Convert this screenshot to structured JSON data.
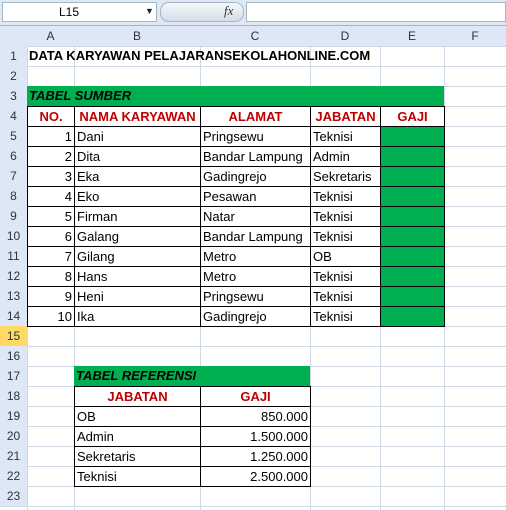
{
  "namebox": "L15",
  "fx": "fx",
  "columns": [
    "A",
    "B",
    "C",
    "D",
    "E",
    "F"
  ],
  "rows": [
    "1",
    "2",
    "3",
    "4",
    "5",
    "6",
    "7",
    "8",
    "9",
    "10",
    "11",
    "12",
    "13",
    "14",
    "15",
    "16",
    "17",
    "18",
    "19",
    "20",
    "21",
    "22",
    "23"
  ],
  "title": "DATA KARYAWAN PELAJARANSEKOLAHONLINE.COM",
  "tabel_sumber": {
    "label": "TABEL SUMBER",
    "headers": [
      "NO.",
      "NAMA KARYAWAN",
      "ALAMAT",
      "JABATAN",
      "GAJI"
    ],
    "rows": [
      [
        "1",
        "Dani",
        "Pringsewu",
        "Teknisi"
      ],
      [
        "2",
        "Dita",
        "Bandar Lampung",
        "Admin"
      ],
      [
        "3",
        "Eka",
        "Gadingrejo",
        "Sekretaris"
      ],
      [
        "4",
        "Eko",
        "Pesawan",
        "Teknisi"
      ],
      [
        "5",
        "Firman",
        "Natar",
        "Teknisi"
      ],
      [
        "6",
        "Galang",
        "Bandar Lampung",
        "Teknisi"
      ],
      [
        "7",
        "Gilang",
        "Metro",
        "OB"
      ],
      [
        "8",
        "Hans",
        "Metro",
        "Teknisi"
      ],
      [
        "9",
        "Heni",
        "Pringsewu",
        "Teknisi"
      ],
      [
        "10",
        "Ika",
        "Gadingrejo",
        "Teknisi"
      ]
    ]
  },
  "tabel_referensi": {
    "label": "TABEL REFERENSI",
    "headers": [
      "JABATAN",
      "GAJI"
    ],
    "rows": [
      [
        "OB",
        "850.000"
      ],
      [
        "Admin",
        "1.500.000"
      ],
      [
        "Sekretaris",
        "1.250.000"
      ],
      [
        "Teknisi",
        "2.500.000"
      ]
    ]
  },
  "colors": {
    "green": "#00b050",
    "header_red": "#c00000",
    "selected_row": "#ffd966"
  }
}
